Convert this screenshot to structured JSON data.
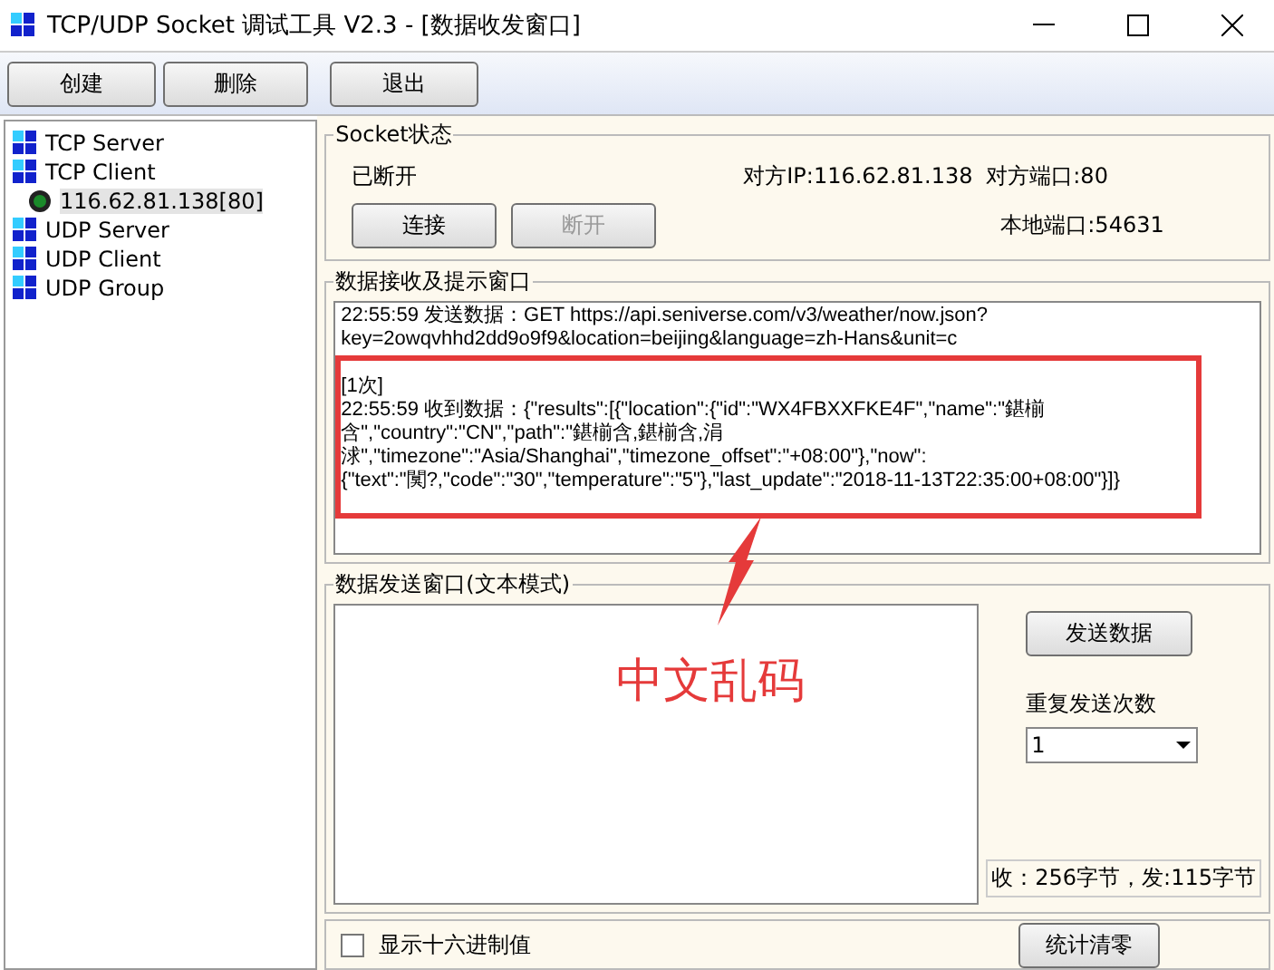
{
  "window": {
    "title": "TCP/UDP Socket 调试工具 V2.3 - [数据收发窗口]"
  },
  "toolbar": [
    "创建",
    "删除",
    "退出"
  ],
  "tree": [
    {
      "label": "TCP Server"
    },
    {
      "label": "TCP Client",
      "children": [
        {
          "label": "116.62.81.138[80]",
          "selected": true
        }
      ]
    },
    {
      "label": "UDP Server"
    },
    {
      "label": "UDP Client"
    },
    {
      "label": "UDP Group"
    }
  ],
  "socket_status": {
    "title": "Socket状态",
    "state": "已断开",
    "remote_ip": "对方IP:116.62.81.138",
    "remote_port": "对方端口:80",
    "local_port": "本地端口:54631",
    "buttons": [
      {
        "label": "连接",
        "disabled": false
      },
      {
        "label": "断开",
        "disabled": true
      }
    ]
  },
  "receive": {
    "title": "数据接收及提示窗口",
    "blocks": [
      {
        "lines": [
          "22:55:59 发送数据：GET https://api.seniverse.com/v3/weather/now.json?",
          "key=2owqvhhd2dd9o9f9&location=beijing&language=zh-Hans&unit=c"
        ]
      },
      {
        "lines": [
          "[1次]",
          "22:55:59 收到数据：{\"results\":[{\"location\":{\"id\":\"WX4FBXXFKE4F\",\"name\":\"鍖椾",
          "含\",\"country\":\"CN\",\"path\":\"鍖椾含,鍖椾含,涓",
          "浗\",\"timezone\":\"Asia/Shanghai\",\"timezone_offset\":\"+08:00\"},\"now\":",
          "{\"text\":\"闃?,\"code\":\"30\",\"temperature\":\"5\"},\"last_update\":\"2018-11-13T22:35:00+08:00\"}]}"
        ]
      }
    ]
  },
  "send": {
    "title": "数据发送窗口(文本模式)",
    "send_button": "发送数据",
    "repeat_label": "重复发送次数",
    "repeat_value": "1",
    "stats": "收：256字节，发:115字节"
  },
  "bottom": {
    "hex_label": "显示十六进制值",
    "hex_checked": false,
    "reset_button": "统计清零"
  },
  "annotation": {
    "label": "中文乱码"
  }
}
